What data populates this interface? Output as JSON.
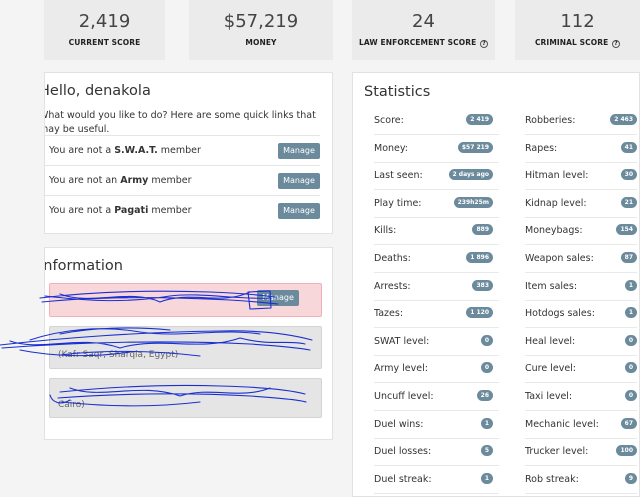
{
  "top_stats": [
    {
      "value": "2,419",
      "label": "CURRENT SCORE",
      "help": false
    },
    {
      "value": "$57,219",
      "label": "MONEY",
      "help": false
    },
    {
      "value": "24",
      "label": "LAW ENFORCEMENT SCORE",
      "help": true
    },
    {
      "value": "112",
      "label": "CRIMINAL SCORE",
      "help": true
    }
  ],
  "help_glyph": "?",
  "hello": {
    "title": "Hello, denakola",
    "subtitle_line1": "What would you like to do? Here are some quick links that",
    "subtitle_line2": "may be useful.",
    "rows": [
      {
        "pre": "You are not a ",
        "bold": "S.W.A.T.",
        "post": " member",
        "button": "Manage"
      },
      {
        "pre": "You are not an ",
        "bold": "Army",
        "post": " member",
        "button": "Manage"
      },
      {
        "pre": "You are not a ",
        "bold": "Pagati",
        "post": " member",
        "button": "Manage"
      }
    ]
  },
  "information": {
    "title": "Information",
    "alert1_button": "Manage",
    "alert2_text": "(Kafr Saqr, Sharqia, Egypt)",
    "alert3_text": "Cairo)"
  },
  "statistics": {
    "title": "Statistics",
    "left": [
      {
        "label": "Score:",
        "value": "2 419"
      },
      {
        "label": "Money:",
        "value": "$57 219"
      },
      {
        "label": "Last seen:",
        "value": "2 days ago"
      },
      {
        "label": "Play time:",
        "value": "239h25m"
      },
      {
        "label": "Kills:",
        "value": "889"
      },
      {
        "label": "Deaths:",
        "value": "1 896"
      },
      {
        "label": "Arrests:",
        "value": "383"
      },
      {
        "label": "Tazes:",
        "value": "1 120"
      },
      {
        "label": "SWAT level:",
        "value": "0"
      },
      {
        "label": "Army level:",
        "value": "0"
      },
      {
        "label": "Uncuff level:",
        "value": "26"
      },
      {
        "label": "Duel wins:",
        "value": "1"
      },
      {
        "label": "Duel losses:",
        "value": "5"
      },
      {
        "label": "Duel streak:",
        "value": "1"
      }
    ],
    "right": [
      {
        "label": "Robberies:",
        "value": "2 463"
      },
      {
        "label": "Rapes:",
        "value": "41"
      },
      {
        "label": "Hitman level:",
        "value": "30"
      },
      {
        "label": "Kidnap level:",
        "value": "21"
      },
      {
        "label": "Moneybags:",
        "value": "154"
      },
      {
        "label": "Weapon sales:",
        "value": "87"
      },
      {
        "label": "Item sales:",
        "value": "1"
      },
      {
        "label": "Hotdogs sales:",
        "value": "1"
      },
      {
        "label": "Heal level:",
        "value": "0"
      },
      {
        "label": "Cure level:",
        "value": "0"
      },
      {
        "label": "Taxi level:",
        "value": "0"
      },
      {
        "label": "Mechanic level:",
        "value": "67"
      },
      {
        "label": "Trucker level:",
        "value": "100"
      },
      {
        "label": "Rob streak:",
        "value": "9"
      }
    ]
  },
  "colors": {
    "badge": "#6b8a9c",
    "scribble": "#1a2fd1",
    "alert_pink": "#f8d7da",
    "alert_grey": "#e5e5e5"
  }
}
